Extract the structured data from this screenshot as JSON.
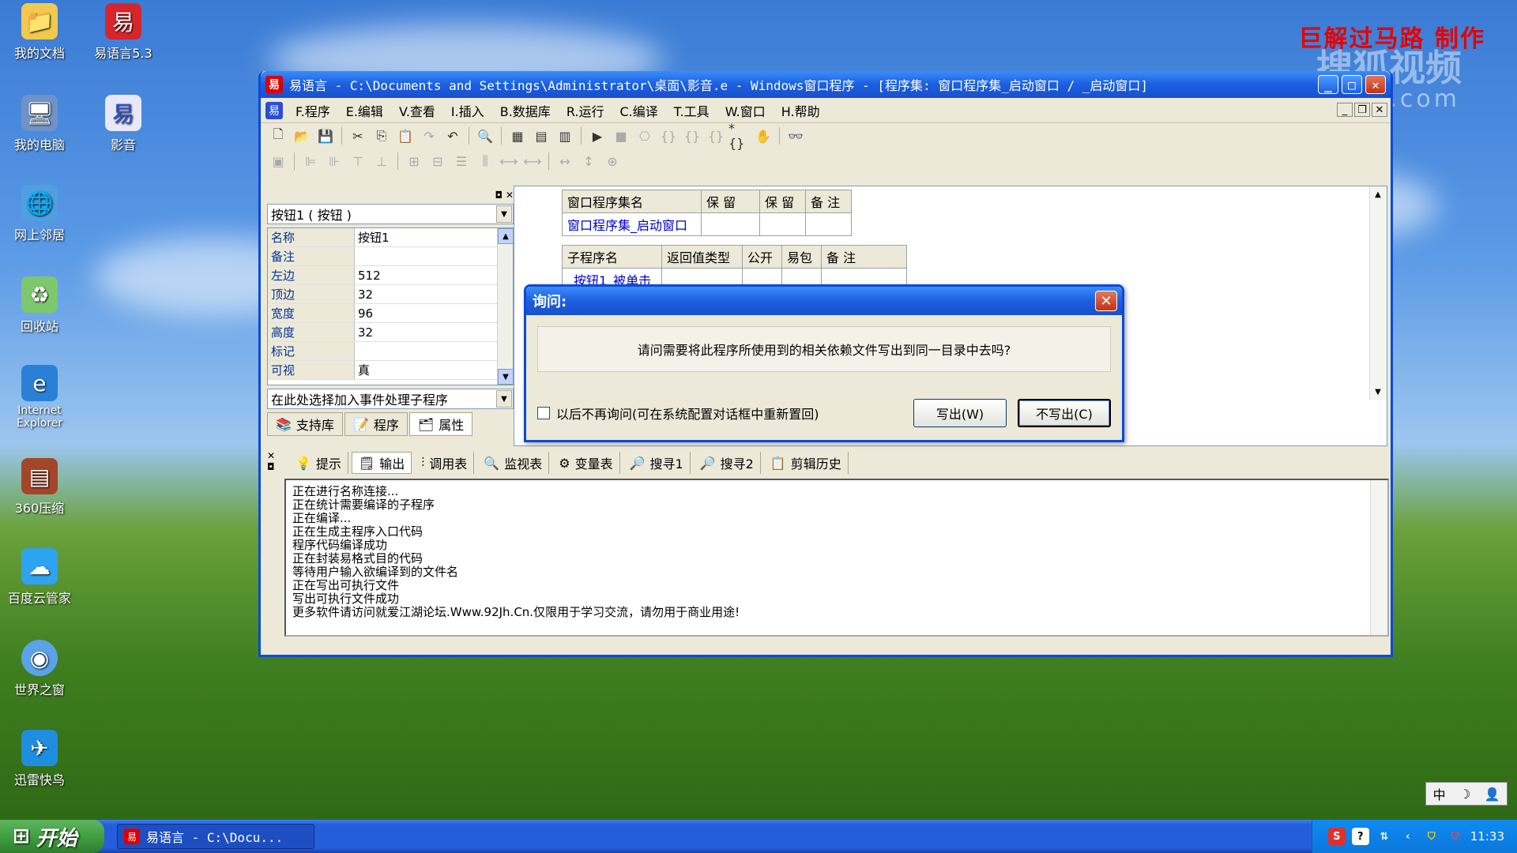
{
  "desktop": {
    "watermark": "巨解过马路  制作",
    "sohu": "搜狐视频",
    "sohu_url": "tv.sohu.com",
    "icons": [
      {
        "label": "我的文档"
      },
      {
        "label": "易语言5.3"
      },
      {
        "label": "我的电脑"
      },
      {
        "label": "影音"
      },
      {
        "label": "网上邻居"
      },
      {
        "label": "回收站"
      },
      {
        "label": "Internet Explorer"
      },
      {
        "label": "360压缩"
      },
      {
        "label": "百度云管家"
      },
      {
        "label": "世界之窗"
      },
      {
        "label": "迅雷快鸟"
      }
    ]
  },
  "window": {
    "title": "易语言 - C:\\Documents and Settings\\Administrator\\桌面\\影音.e - Windows窗口程序 - [程序集: 窗口程序集_启动窗口 / _启动窗口]",
    "menu": [
      "F.程序",
      "E.编辑",
      "V.查看",
      "I.插入",
      "B.数据库",
      "R.运行",
      "C.编译",
      "T.工具",
      "W.窗口",
      "H.帮助"
    ]
  },
  "props": {
    "selector": "按钮1 ( 按钮 )",
    "rows": [
      {
        "k": "名称",
        "v": "按钮1"
      },
      {
        "k": "备注",
        "v": ""
      },
      {
        "k": "左边",
        "v": "512"
      },
      {
        "k": "顶边",
        "v": "32"
      },
      {
        "k": "宽度",
        "v": "96"
      },
      {
        "k": "高度",
        "v": "32"
      },
      {
        "k": "标记",
        "v": ""
      },
      {
        "k": "可视",
        "v": "真"
      }
    ],
    "event_select": "在此处选择加入事件处理子程序",
    "tabs": [
      "支持库",
      "程序",
      "属性"
    ]
  },
  "editor": {
    "t1_headers": [
      "窗口程序集名",
      "保 留",
      "保 留",
      "备 注"
    ],
    "t1_row": [
      "窗口程序集_启动窗口",
      "",
      "",
      ""
    ],
    "t2_headers": [
      "子程序名",
      "返回值类型",
      "公开",
      "易包",
      "备 注"
    ],
    "t2_row": [
      "_按钮1_被单击",
      "",
      "",
      "",
      ""
    ]
  },
  "output": {
    "tabs": [
      "提示",
      "输出",
      "调用表",
      "监视表",
      "变量表",
      "搜寻1",
      "搜寻2",
      "剪辑历史"
    ],
    "lines": [
      "正在进行名称连接...",
      "正在统计需要编译的子程序",
      "正在编译...",
      "正在生成主程序入口代码",
      "程序代码编译成功",
      "正在封装易格式目的代码",
      "等待用户输入欲编译到的文件名",
      "正在写出可执行文件",
      "写出可执行文件成功",
      "更多软件请访问就爱江湖论坛.Www.92Jh.Cn.仅限用于学习交流，请勿用于商业用途!"
    ]
  },
  "dialog": {
    "title": "询问:",
    "message": "请问需要将此程序所使用到的相关依赖文件写出到同一目录中去吗?",
    "checkbox": "以后不再询问(可在系统配置对话框中重新置回)",
    "btn_yes": "写出(W)",
    "btn_no": "不写出(C)"
  },
  "taskbar": {
    "start": "开始",
    "task": "易语言 - C:\\Docu...",
    "time": "11:33",
    "ime": "中"
  }
}
